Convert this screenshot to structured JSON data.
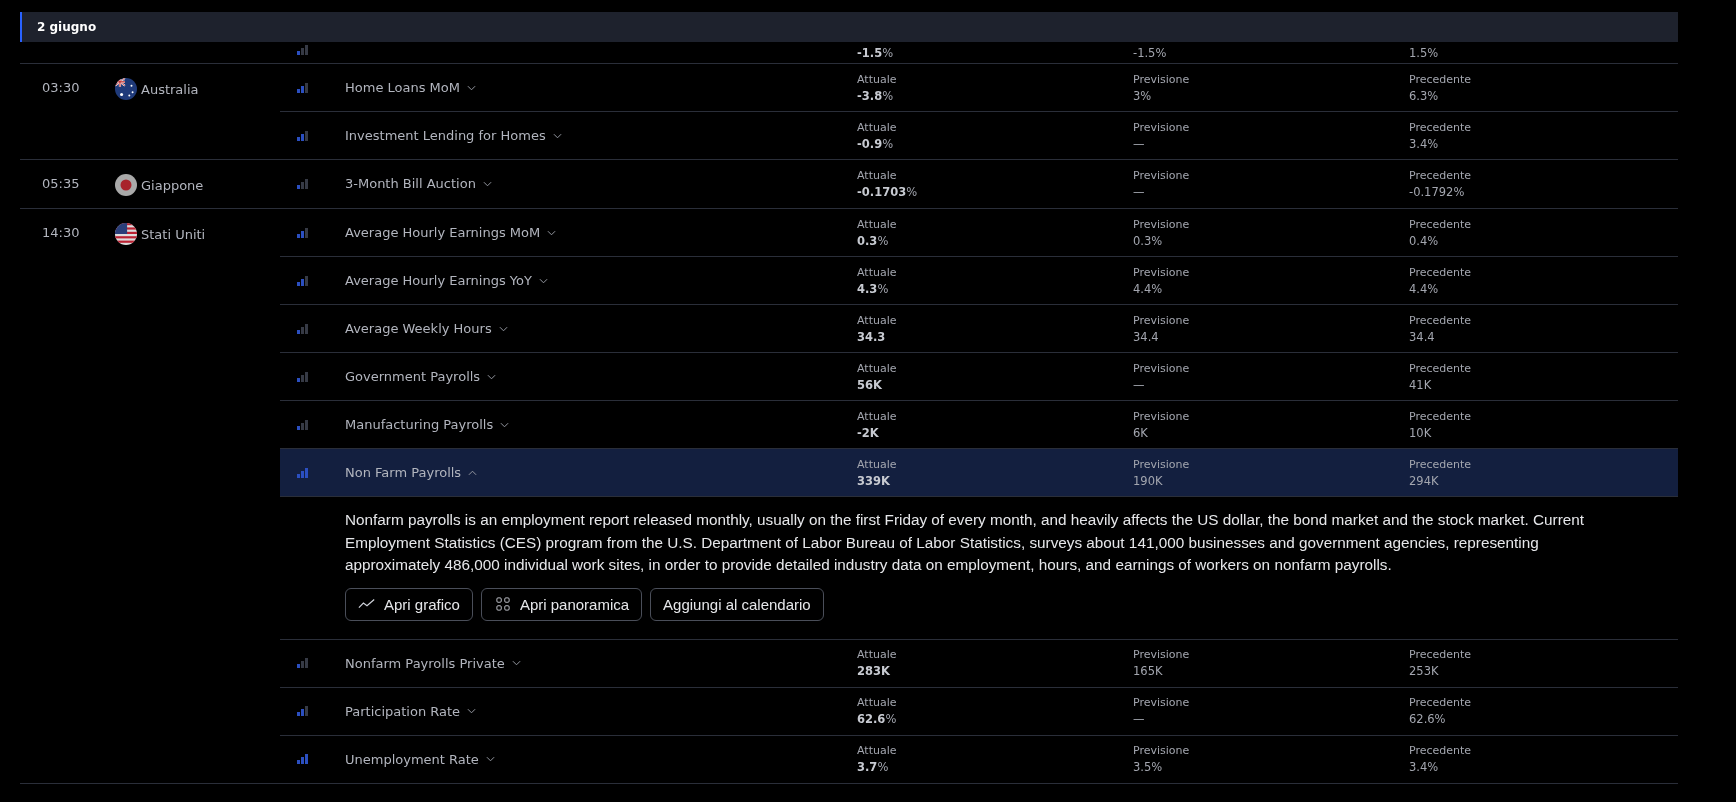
{
  "date_header": {
    "label": "2 giugno"
  },
  "groups": [
    {
      "events": [
        {
          "kind": "low",
          "selected": false,
          "actual": "**-1.5**%",
          "forecast": "-1.5%",
          "previous": "1.5%"
        }
      ]
    },
    {
      "time": "03:30",
      "country": "Australia",
      "kind": "australia",
      "events": [
        {
          "name": "Home Loans MoM",
          "kind": "medium",
          "expanded": false,
          "selected": false,
          "actual_label": "Attuale",
          "actual": "**-3.8**%",
          "forecast_label": "Previsione",
          "forecast": "3%",
          "previous_label": "Precedente",
          "previous": "6.3%"
        },
        {
          "name": "Investment Lending for Homes",
          "kind": "medium",
          "expanded": false,
          "selected": false,
          "actual_label": "Attuale",
          "actual": "**-0.9**%",
          "forecast_label": "Previsione",
          "forecast": "—",
          "previous_label": "Precedente",
          "previous": "3.4%"
        }
      ]
    },
    {
      "time": "05:35",
      "country": "Giappone",
      "kind": "japan",
      "events": [
        {
          "name": "3-Month Bill Auction",
          "kind": "low",
          "expanded": false,
          "selected": false,
          "actual_label": "Attuale",
          "actual": "**-0.1703**%",
          "forecast_label": "Previsione",
          "forecast": "—",
          "previous_label": "Precedente",
          "previous": "-0.1792%"
        }
      ]
    },
    {
      "time": "14:30",
      "country": "Stati Uniti",
      "kind": "usa",
      "events": [
        {
          "name": "Average Hourly Earnings MoM",
          "kind": "medium",
          "expanded": false,
          "selected": false,
          "actual_label": "Attuale",
          "actual": "**0.3**%",
          "forecast_label": "Previsione",
          "forecast": "0.3%",
          "previous_label": "Precedente",
          "previous": "0.4%"
        },
        {
          "name": "Average Hourly Earnings YoY",
          "kind": "medium",
          "expanded": false,
          "selected": false,
          "actual_label": "Attuale",
          "actual": "**4.3**%",
          "forecast_label": "Previsione",
          "forecast": "4.4%",
          "previous_label": "Precedente",
          "previous": "4.4%"
        },
        {
          "name": "Average Weekly Hours",
          "kind": "low",
          "expanded": false,
          "selected": false,
          "actual_label": "Attuale",
          "actual": "**34.3**",
          "forecast_label": "Previsione",
          "forecast": "34.4",
          "previous_label": "Precedente",
          "previous": "34.4"
        },
        {
          "name": "Government Payrolls",
          "kind": "low",
          "expanded": false,
          "selected": false,
          "actual_label": "Attuale",
          "actual": "**56K**",
          "forecast_label": "Previsione",
          "forecast": "—",
          "previous_label": "Precedente",
          "previous": "41K"
        },
        {
          "name": "Manufacturing Payrolls",
          "kind": "low",
          "expanded": false,
          "selected": false,
          "actual_label": "Attuale",
          "actual": "**-2K**",
          "forecast_label": "Previsione",
          "forecast": "6K",
          "previous_label": "Precedente",
          "previous": "10K"
        },
        {
          "name": "Non Farm Payrolls",
          "kind": "high",
          "expanded": true,
          "selected": true,
          "actual_label": "Attuale",
          "actual": "**339K**",
          "forecast_label": "Previsione",
          "forecast": "190K",
          "previous_label": "Precedente",
          "previous": "294K",
          "description": "Nonfarm payrolls is an employment report released monthly, usually on the first Friday of every month, and heavily affects the US dollar, the bond market and the stock market. Current Employment Statistics (CES) program from the U.S. Department of Labor Bureau of Labor Statistics, surveys about 141,000 businesses and government agencies, representing approximately 486,000 individual work sites, in order to provide detailed industry data on employment, hours, and earnings of workers on nonfarm payrolls.",
          "buttons": [
            {
              "label": "Apri grafico",
              "kind": "chart"
            },
            {
              "label": "Apri panoramica",
              "kind": "overview"
            },
            {
              "label": "Aggiungi al calendario",
              "kind": "plain"
            }
          ]
        },
        {
          "name": "Nonfarm Payrolls Private",
          "kind": "low",
          "expanded": false,
          "selected": false,
          "actual_label": "Attuale",
          "actual": "**283K**",
          "forecast_label": "Previsione",
          "forecast": "165K",
          "previous_label": "Precedente",
          "previous": "253K"
        },
        {
          "name": "Participation Rate",
          "kind": "medium",
          "expanded": false,
          "selected": false,
          "actual_label": "Attuale",
          "actual": "**62.6**%",
          "forecast_label": "Previsione",
          "forecast": "—",
          "previous_label": "Precedente",
          "previous": "62.6%"
        },
        {
          "name": "Unemployment Rate",
          "kind": "high",
          "expanded": false,
          "selected": false,
          "actual_label": "Attuale",
          "actual": "**3.7**%",
          "forecast_label": "Previsione",
          "forecast": "3.5%",
          "previous_label": "Precedente",
          "previous": "3.4%"
        }
      ]
    }
  ]
}
